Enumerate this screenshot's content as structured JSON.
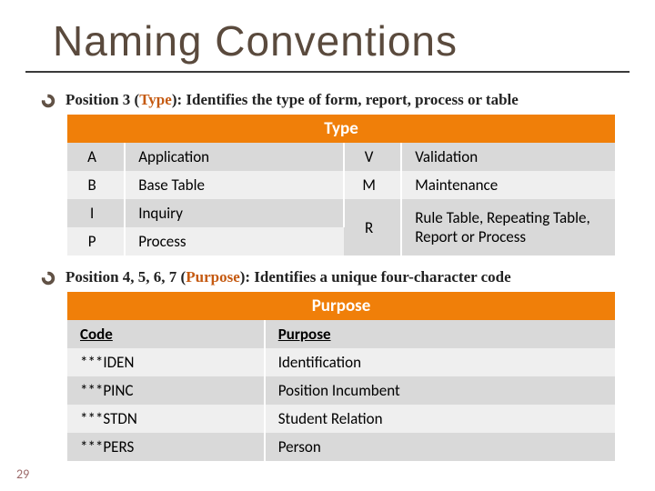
{
  "title": "Naming Conventions",
  "slide_number": "29",
  "bullet1": {
    "pre": "Position 3 (",
    "kw": "Type",
    "post": "): Identifies the type of form, report, process or table"
  },
  "type_table": {
    "header": "Type",
    "rows": [
      {
        "c1": "A",
        "d1": "Application",
        "c2": "V",
        "d2": "Validation"
      },
      {
        "c1": "B",
        "d1": "Base Table",
        "c2": "M",
        "d2": "Maintenance"
      },
      {
        "c1": "I",
        "d1": "Inquiry",
        "c2": "R",
        "d2": "Rule Table, Repeating Table, Report or Process"
      },
      {
        "c1": "P",
        "d1": "Process",
        "c2": "",
        "d2": ""
      }
    ]
  },
  "bullet2": {
    "pre": "Position 4, 5, 6, 7 (",
    "kw": "Purpose",
    "post": "): Identifies a unique four-character code"
  },
  "purpose_table": {
    "header": "Purpose",
    "col1": "Code",
    "col2": "Purpose",
    "rows": [
      {
        "code": "***IDEN",
        "desc": "Identification"
      },
      {
        "code": "***PINC",
        "desc": "Position Incumbent"
      },
      {
        "code": "***STDN",
        "desc": "Student Relation"
      },
      {
        "code": "***PERS",
        "desc": "Person"
      }
    ]
  }
}
